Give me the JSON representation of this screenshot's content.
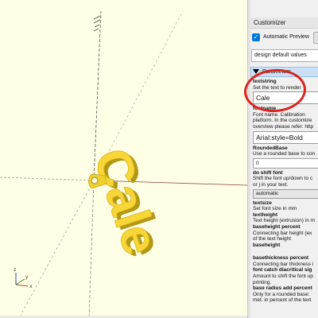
{
  "customizer": {
    "title": "Customizer",
    "automatic_preview_label": "Automatic Preview",
    "automatic_preview_checked": true,
    "preset_value": "design default values",
    "parameters_header": "Parameters"
  },
  "fields": [
    {
      "type": "label",
      "text": "textstring"
    },
    {
      "type": "desc",
      "text": "Set the text to render"
    },
    {
      "type": "input-big",
      "text": "Cale"
    },
    {
      "type": "label",
      "text": "fontname"
    },
    {
      "type": "desc",
      "text": "Font name. Calibration"
    },
    {
      "type": "desc",
      "text": "platform. In the customize"
    },
    {
      "type": "desc",
      "text": "overview please refer: http"
    },
    {
      "type": "input-big",
      "text": "Arial:style=Bold"
    },
    {
      "type": "label",
      "text": "RoundedBase"
    },
    {
      "type": "desc",
      "text": "Use a rounded base to con"
    },
    {
      "type": "input",
      "text": "0"
    },
    {
      "type": "label",
      "text": "do shift font"
    },
    {
      "type": "desc",
      "text": "Shift the font up/down to c"
    },
    {
      "type": "desc",
      "text": "or j in your text."
    },
    {
      "type": "select",
      "text": "automatic"
    },
    {
      "type": "label",
      "text": "textsize"
    },
    {
      "type": "desc",
      "text": "Set font size in mm"
    },
    {
      "type": "label",
      "text": "textheight"
    },
    {
      "type": "desc",
      "text": "Text height (extrusion) in m"
    },
    {
      "type": "label",
      "text": "baseheight percent"
    },
    {
      "type": "desc",
      "text": "Connecting bar height (ex"
    },
    {
      "type": "desc",
      "text": "of the text height"
    },
    {
      "type": "label",
      "text": "baseheight"
    },
    {
      "type": "gap",
      "text": ""
    },
    {
      "type": "label",
      "text": "basethickness percent"
    },
    {
      "type": "desc",
      "text": "Connecting bar thickness i"
    },
    {
      "type": "label",
      "text": "font catch diacritical sig"
    },
    {
      "type": "desc",
      "text": "Amount to shift the font up"
    },
    {
      "type": "desc",
      "text": "printing."
    },
    {
      "type": "label",
      "text": "base radius add percent"
    },
    {
      "type": "desc",
      "text": "Only for a rounded base:"
    },
    {
      "type": "desc",
      "text": "met. in percent of the text"
    }
  ],
  "model": {
    "text": "Cale",
    "color": "#f8d635"
  },
  "axes": {
    "colors": {
      "x": "#c0392b",
      "y": "#2e8b2e",
      "z": "#1f4fbf"
    },
    "gizmo_labels": {
      "x": "x",
      "y": "y",
      "z": "z"
    }
  }
}
